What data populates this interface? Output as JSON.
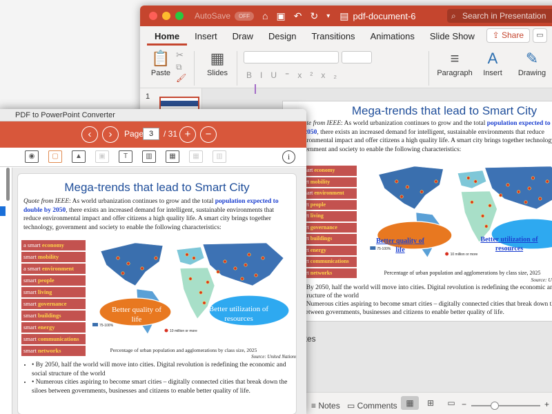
{
  "ppt": {
    "autosave_label": "AutoSave",
    "autosave_state": "OFF",
    "document_title": "pdf-document-6",
    "search_placeholder": "Search in Presentation",
    "tabs": [
      "Home",
      "Insert",
      "Draw",
      "Design",
      "Transitions",
      "Animations",
      "Slide Show"
    ],
    "share_label": "Share",
    "ribbon": {
      "paste": "Paste",
      "slides": "Slides",
      "paragraph": "Paragraph",
      "insert": "Insert",
      "drawing": "Drawing"
    },
    "thumb_number": "1",
    "notes_label": "otes",
    "status": {
      "notes": "Notes",
      "comments": "Comments"
    },
    "accent": "#c5452e"
  },
  "converter": {
    "window_title": "PDF to PowerPoint Converter",
    "page_label": "Page",
    "page_current": "3",
    "page_total": "/ 31",
    "accent": "#d8573b"
  },
  "slide": {
    "title": "Mega-trends that lead to Smart City",
    "intro_source": "Quote from IEEE",
    "intro_a": ": As world urbanization continues to grow and the total ",
    "intro_highlight": "population expected to double by 2050",
    "intro_b": ", there exists an increased demand for intelligent, sustainable environments that reduce environmental impact and offer citizens a high quality life. A smart city brings together technology, government and society to enable the following characteristics:",
    "tiles": [
      {
        "prefix": "a smart ",
        "keyword": "economy"
      },
      {
        "prefix": "smart ",
        "keyword": "mobility"
      },
      {
        "prefix": "a smart ",
        "keyword": "environment"
      },
      {
        "prefix": "smart ",
        "keyword": "people"
      },
      {
        "prefix": "smart ",
        "keyword": "living"
      },
      {
        "prefix": "smart ",
        "keyword": "governance"
      },
      {
        "prefix": "smart ",
        "keyword": "buildings"
      },
      {
        "prefix": "smart ",
        "keyword": "energy"
      },
      {
        "prefix": "smart ",
        "keyword": "communications"
      },
      {
        "prefix": "smart ",
        "keyword": "networks"
      }
    ],
    "cloud_left": "Better quality of life",
    "cloud_right": "Better utilization of resources",
    "legend_a": "75-100%",
    "legend_b": "10 million or more",
    "caption": "Percentage of urban population and agglomerations by class size, 2025",
    "source": "Source: United Nations",
    "bullets": [
      "By 2050, half the world will move into cities. Digital revolution is redefining the economic and social structure of the world",
      "Numerous cities aspiring to become smart cities – digitally connected cities that break down the siloes between governments, businesses and citizens to enable better quality of life."
    ]
  }
}
